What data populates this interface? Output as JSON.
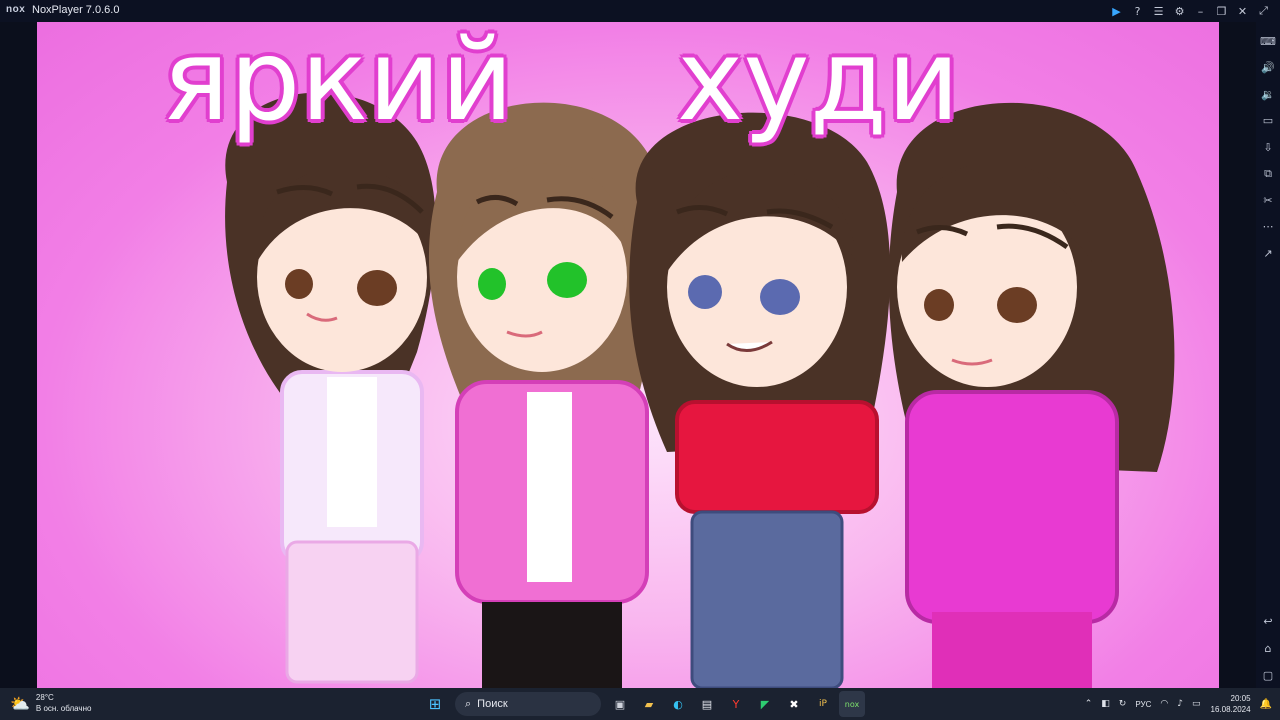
{
  "window": {
    "logo": "nox",
    "title": "NoxPlayer 7.0.6.0",
    "controls": [
      {
        "name": "play-icon",
        "glyph": "▶"
      },
      {
        "name": "help-icon",
        "glyph": "?"
      },
      {
        "name": "menu-icon",
        "glyph": "☰"
      },
      {
        "name": "settings-icon",
        "glyph": "⚙"
      },
      {
        "name": "minimize-icon",
        "glyph": "–"
      },
      {
        "name": "restore-icon",
        "glyph": "❐"
      },
      {
        "name": "close-icon",
        "glyph": "✕"
      },
      {
        "name": "expand-icon",
        "glyph": "⤢"
      }
    ]
  },
  "sidebar": {
    "items": [
      {
        "name": "keyboard-icon",
        "glyph": "⌨"
      },
      {
        "name": "volume-up-icon",
        "glyph": "🔊"
      },
      {
        "name": "volume-down-icon",
        "glyph": "🔉"
      },
      {
        "name": "screen-icon",
        "glyph": "▭"
      },
      {
        "name": "install-apk-icon",
        "glyph": "⇩"
      },
      {
        "name": "multi-instance-icon",
        "glyph": "⧉"
      },
      {
        "name": "screenshot-icon",
        "glyph": "✂"
      },
      {
        "name": "more-icon",
        "glyph": "⋯"
      },
      {
        "name": "open-folder-icon",
        "glyph": "↗"
      }
    ],
    "bottom": [
      {
        "name": "back-icon",
        "glyph": "↩"
      },
      {
        "name": "home-icon",
        "glyph": "⌂"
      },
      {
        "name": "recent-apps-icon",
        "glyph": "▢"
      }
    ]
  },
  "screen": {
    "caption_left": "яркий",
    "caption_right": "худи"
  },
  "taskbar": {
    "weather_temp": "28°C",
    "weather_desc": "В осн. облачно",
    "search_placeholder": "Поиск",
    "language": "РУС",
    "time": "20:05",
    "date": "16.08.2024"
  },
  "colors": {
    "background_pink": "#f27fe6",
    "caption_outline": "#e13fcf",
    "hair_dark": "#4a3226",
    "hair_light": "#8c6a4f",
    "pink_hoodie": "#f06fd3",
    "magenta_shirt": "#e83ad2",
    "red_top": "#e6163f",
    "jeans": "#5a6a9e"
  }
}
